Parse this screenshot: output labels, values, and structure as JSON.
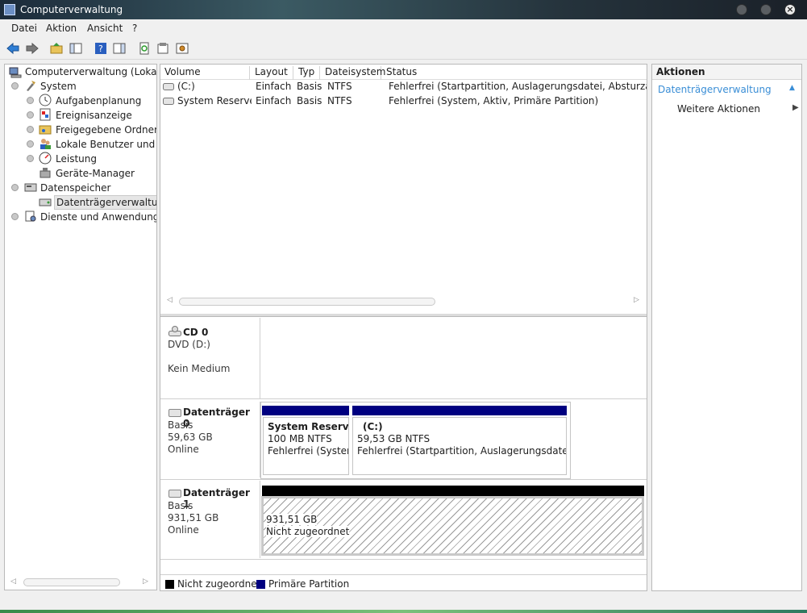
{
  "window": {
    "title": "Computerverwaltung"
  },
  "menu": {
    "items": [
      "Datei",
      "Aktion",
      "Ansicht",
      "?"
    ]
  },
  "tree": {
    "root": "Computerverwaltung (Lokal)",
    "system": "System",
    "system_children": [
      "Aufgabenplanung",
      "Ereignisanzeige",
      "Freigegebene Ordner",
      "Lokale Benutzer und Gruppen",
      "Leistung",
      "Geräte-Manager"
    ],
    "storage": "Datenspeicher",
    "storage_children": [
      "Datenträgerverwaltung"
    ],
    "services": "Dienste und Anwendungen"
  },
  "volumes": {
    "columns": [
      "Volume",
      "Layout",
      "Typ",
      "Dateisystem",
      "Status"
    ],
    "rows": [
      {
        "volume": "(C:)",
        "layout": "Einfach",
        "type": "Basis",
        "fs": "NTFS",
        "status": "Fehlerfrei (Startpartition, Auslagerungsdatei, Absturzabbild, P"
      },
      {
        "volume": "System Reserved",
        "layout": "Einfach",
        "type": "Basis",
        "fs": "NTFS",
        "status": "Fehlerfrei (System, Aktiv, Primäre Partition)"
      }
    ]
  },
  "disks": {
    "cd0": {
      "name": "CD 0",
      "line1": "DVD (D:)",
      "line2": "Kein Medium"
    },
    "disk0": {
      "name": "Datenträger 0",
      "type": "Basis",
      "size": "59,63 GB",
      "state": "Online",
      "partitions": [
        {
          "title": "System Reserved",
          "size": "100 MB NTFS",
          "status": "Fehlerfrei (System,"
        },
        {
          "title": "(C:)",
          "size": "59,53 GB NTFS",
          "status": "Fehlerfrei (Startpartition, Auslagerungsdatei, Abs"
        }
      ]
    },
    "disk1": {
      "name": "Datenträger 1",
      "type": "Basis",
      "size": "931,51 GB",
      "state": "Online",
      "unallocated": {
        "size": "931,51 GB",
        "label": "Nicht zugeordnet"
      }
    }
  },
  "legend": {
    "unallocated": "Nicht zugeordnet",
    "primary": "Primäre Partition",
    "unallocated_color": "#000000",
    "primary_color": "#000080"
  },
  "actions": {
    "header": "Aktionen",
    "section": "Datenträgerverwaltung",
    "more": "Weitere Aktionen"
  }
}
